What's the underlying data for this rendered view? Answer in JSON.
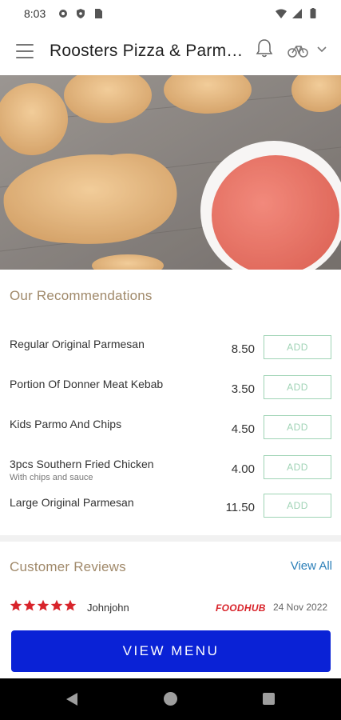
{
  "status_bar": {
    "time": "8:03",
    "left_icons": [
      "gear-icon",
      "shield-icon",
      "sim-card-icon"
    ],
    "right_icons": [
      "wifi-icon",
      "signal-icon",
      "battery-icon"
    ]
  },
  "header": {
    "title": "Roosters Pizza & Parm…",
    "icons": [
      "hamburger-menu-icon",
      "bell-icon",
      "bicycle-icon",
      "chevron-down-icon"
    ]
  },
  "hero": {
    "image_description": "fried-chicken-with-sauce-photo"
  },
  "recommendations": {
    "heading": "Our Recommendations",
    "add_label": "ADD",
    "items": [
      {
        "name": "Regular Original Parmesan",
        "description": "",
        "price": "8.50"
      },
      {
        "name": "Portion Of Donner Meat Kebab",
        "description": "",
        "price": "3.50"
      },
      {
        "name": "Kids Parmo And Chips",
        "description": "",
        "price": "4.50"
      },
      {
        "name": "3pcs Southern Fried Chicken",
        "description": "With chips and sauce",
        "price": "4.00"
      },
      {
        "name": "Large Original Parmesan",
        "description": "",
        "price": "11.50"
      }
    ]
  },
  "reviews": {
    "heading": "Customer Reviews",
    "view_all_label": "View All",
    "items": [
      {
        "rating": 5,
        "reviewer": "Johnjohn",
        "source": "FOODHUB",
        "date": "24 Nov 2022"
      }
    ]
  },
  "cta": {
    "view_menu_label": "VIEW MENU"
  },
  "colors": {
    "accent_heading": "#a0896a",
    "add_button": "#9fd3b5",
    "view_menu_bg": "#0a22d6",
    "link": "#2b7fb8",
    "star": "#d8232a"
  }
}
